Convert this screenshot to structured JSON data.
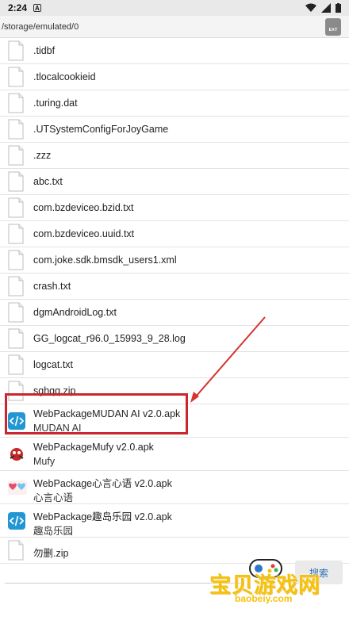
{
  "status_bar": {
    "time": "2:24",
    "notification_badge": "A"
  },
  "path_bar": {
    "path": "/storage/emulated/0",
    "ext_button_label": "EXT"
  },
  "files": [
    {
      "name": ".tidbf",
      "type": "file"
    },
    {
      "name": ".tlocalcookieid",
      "type": "file"
    },
    {
      "name": ".turing.dat",
      "type": "file"
    },
    {
      "name": ".UTSystemConfigForJoyGame",
      "type": "file"
    },
    {
      "name": ".zzz",
      "type": "file"
    },
    {
      "name": "abc.txt",
      "type": "file"
    },
    {
      "name": "com.bzdeviceo.bzid.txt",
      "type": "file"
    },
    {
      "name": "com.bzdeviceo.uuid.txt",
      "type": "file"
    },
    {
      "name": "com.joke.sdk.bmsdk_users1.xml",
      "type": "file"
    },
    {
      "name": "crash.txt",
      "type": "file"
    },
    {
      "name": "dgmAndroidLog.txt",
      "type": "file"
    },
    {
      "name": "GG_logcat_r96.0_15993_9_28.log",
      "type": "file"
    },
    {
      "name": "logcat.txt",
      "type": "file"
    },
    {
      "name": "sghqq.zip",
      "type": "file"
    },
    {
      "name": "WebPackageMUDAN AI v2.0.apk",
      "sub": "MUDAN AI",
      "type": "apk-code"
    },
    {
      "name": "WebPackageMufy v2.0.apk",
      "sub": "Mufy",
      "type": "apk-mufy"
    },
    {
      "name": "WebPackage心言心语 v2.0.apk",
      "sub": "心言心语",
      "type": "apk-xinyan"
    },
    {
      "name": "WebPackage趣岛乐园 v2.0.apk",
      "sub": "趣岛乐园",
      "type": "apk-code"
    },
    {
      "name": "勿删.zip",
      "type": "file"
    }
  ],
  "search_button_label": "搜索",
  "watermark": {
    "text": "宝贝游戏网",
    "url": "baobeiy.com"
  },
  "colors": {
    "highlight": "#c9272d",
    "apk_icon": "#2196d3",
    "watermark": "#f4c20d"
  }
}
